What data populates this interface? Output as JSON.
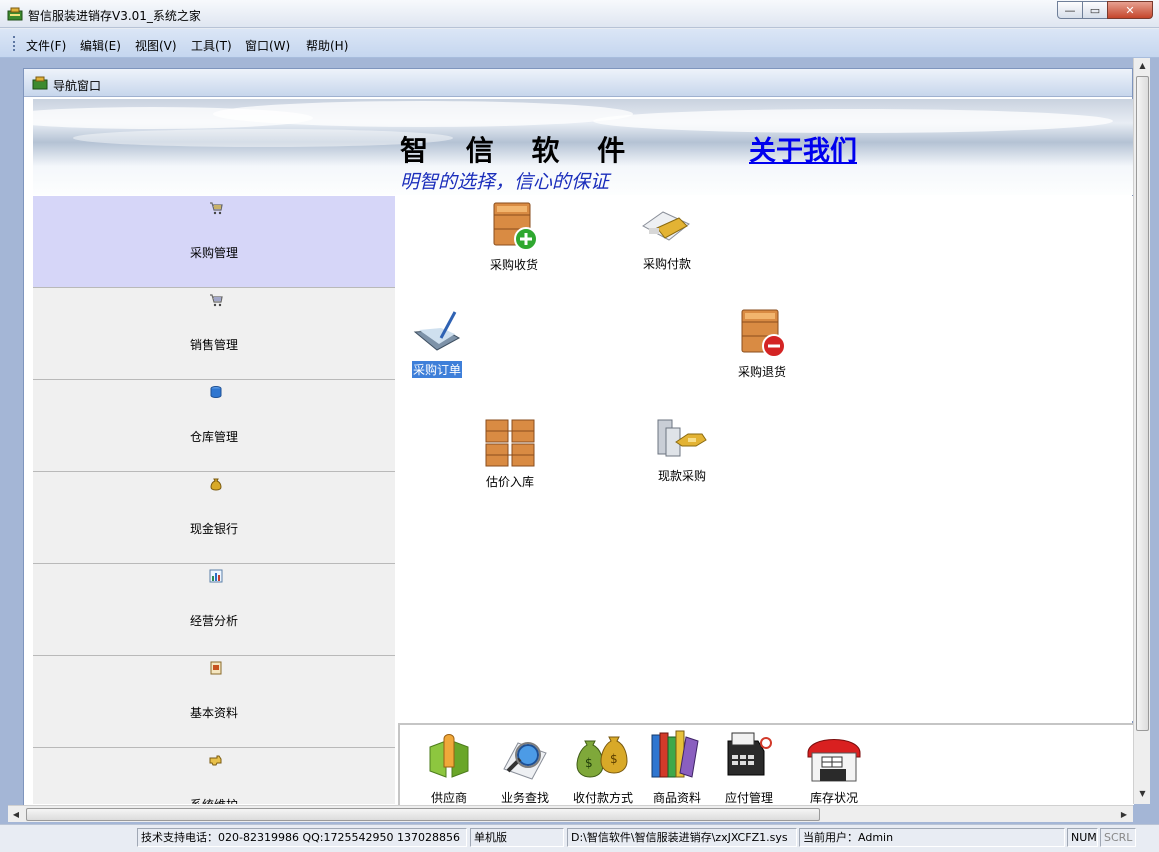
{
  "window": {
    "title": "智信服装进销存V3.01_系统之家",
    "controls": {
      "minimize": "—",
      "maximize": "▭",
      "close": "✕"
    }
  },
  "menu": [
    "文件(F)",
    "编辑(E)",
    "视图(V)",
    "工具(T)",
    "窗口(W)",
    "帮助(H)"
  ],
  "child_window": {
    "title": "导航窗口"
  },
  "banner": {
    "brand": "智 信 软 件",
    "about_link": "关于我们",
    "slogan": "明智的选择，信心的保证"
  },
  "nav": [
    {
      "label": "采购管理",
      "icon": "shopping-cart-icon",
      "active": true
    },
    {
      "label": "销售管理",
      "icon": "shopping-cart-icon",
      "active": false
    },
    {
      "label": "仓库管理",
      "icon": "database-icon",
      "active": false
    },
    {
      "label": "现金银行",
      "icon": "money-bag-icon",
      "active": false
    },
    {
      "label": "经营分析",
      "icon": "chart-icon",
      "active": false
    },
    {
      "label": "基本资料",
      "icon": "document-icon",
      "active": false
    },
    {
      "label": "系统维护",
      "icon": "hand-pointer-icon",
      "active": false
    }
  ],
  "tools": [
    {
      "label": "采购收货",
      "icon": "box-add-icon",
      "selected": false
    },
    {
      "label": "采购付款",
      "icon": "payment-card-icon",
      "selected": false
    },
    {
      "label": "采购订单",
      "icon": "order-pen-icon",
      "selected": true
    },
    {
      "label": "采购退货",
      "icon": "box-remove-icon",
      "selected": false
    },
    {
      "label": "估价入库",
      "icon": "stacked-boxes-icon",
      "selected": false
    },
    {
      "label": "现款采购",
      "icon": "cash-purchase-icon",
      "selected": false
    }
  ],
  "bottom_tools": [
    {
      "label": "供应商",
      "icon": "supplier-icon"
    },
    {
      "label": "业务查找",
      "icon": "magnifier-globe-icon"
    },
    {
      "label": "收付款方式",
      "icon": "money-bags-icon"
    },
    {
      "label": "商品资料",
      "icon": "books-icon"
    },
    {
      "label": "应付管理",
      "icon": "cash-register-icon"
    },
    {
      "label": "库存状况",
      "icon": "warehouse-icon"
    }
  ],
  "status": {
    "support": "技术支持电话：020-82319986 QQ:1725542950 137028856",
    "edition": "单机版",
    "path": "D:\\智信软件\\智信服装进销存\\zxJXCFZ1.sys",
    "user": "当前用户：Admin",
    "num": "NUM",
    "scrl": "SCRL"
  },
  "colors": {
    "nav_active": "#d6d6f8",
    "link": "#0000ee",
    "slogan": "#1a2dbb",
    "selection": "#3e7fd9"
  }
}
